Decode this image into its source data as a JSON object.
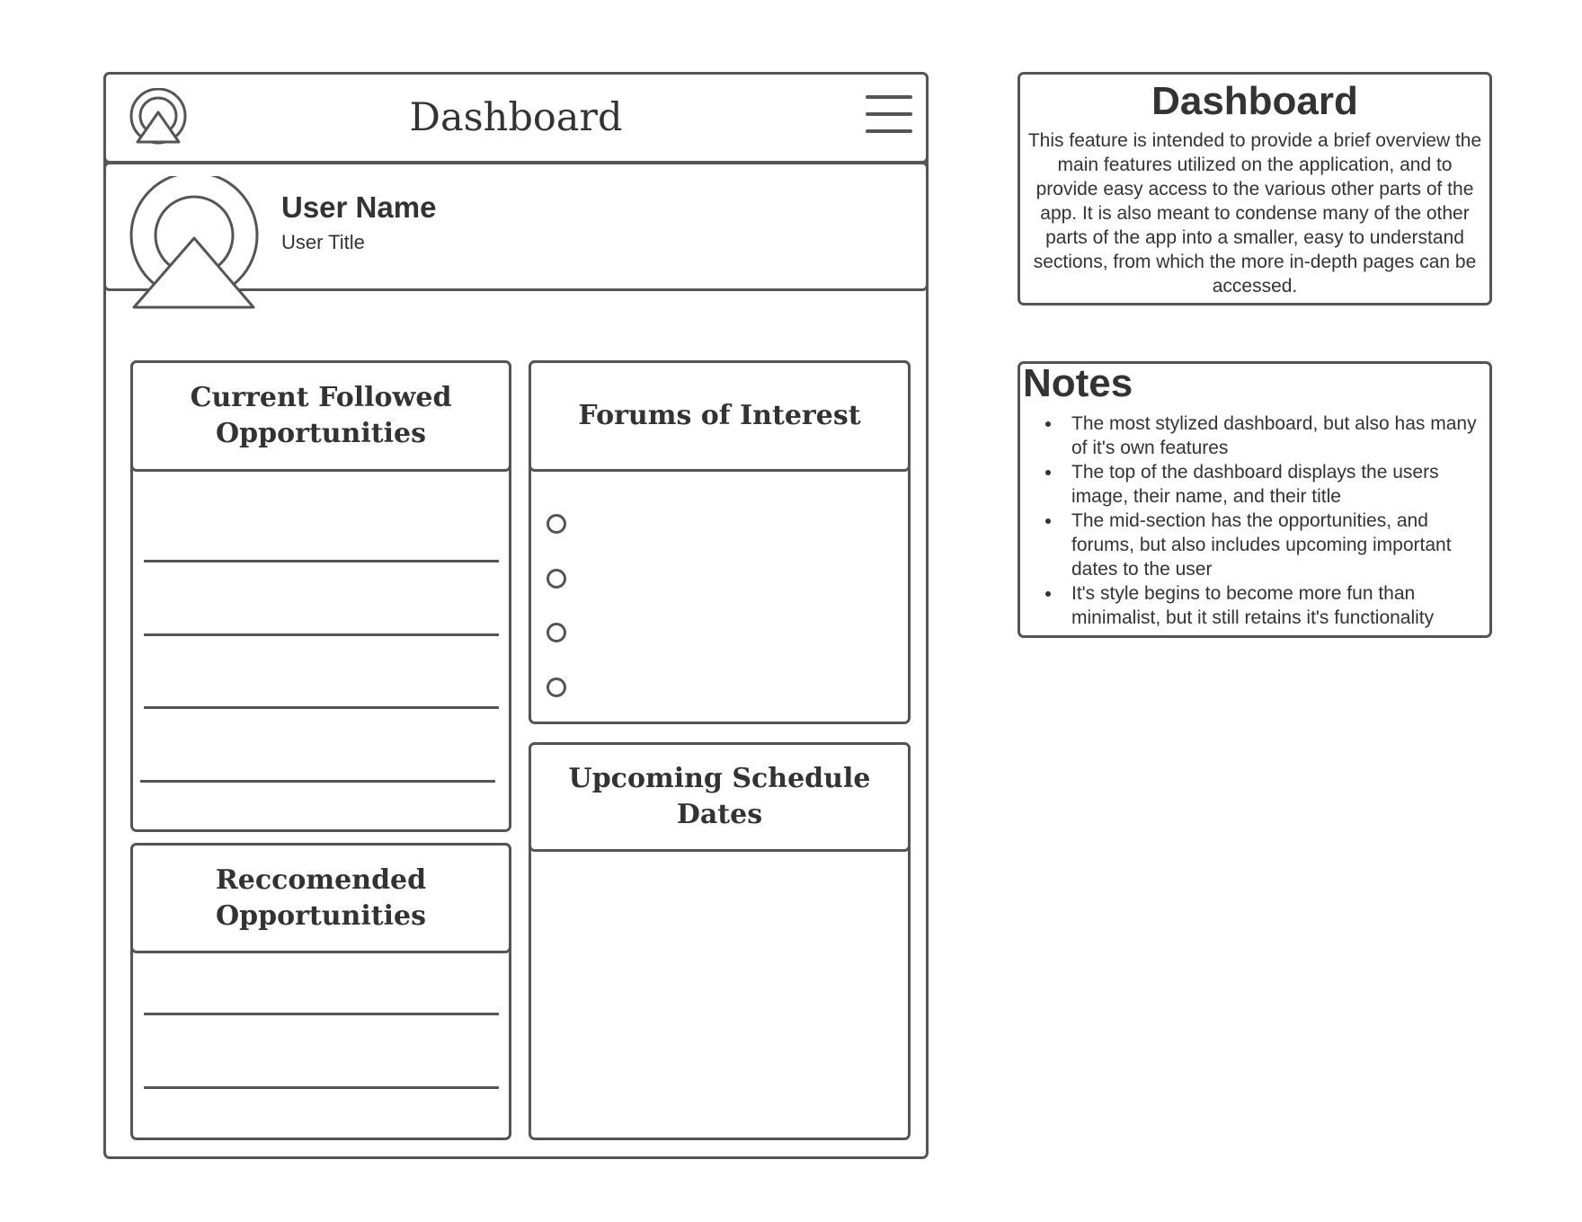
{
  "app": {
    "title": "Dashboard"
  },
  "profile": {
    "user_name": "User Name",
    "user_title": "User Title"
  },
  "cards": {
    "followed": {
      "title": "Current Followed Opportunities"
    },
    "forums": {
      "title": "Forums of Interest"
    },
    "schedule": {
      "title": "Upcoming Schedule Dates"
    },
    "recommended": {
      "title": "Reccomended Opportunities"
    }
  },
  "description": {
    "title": "Dashboard",
    "text": "This feature is intended to provide a brief overview the main features utilized on the application, and to provide easy access to the various other parts of the app. It is also meant to condense many of the other parts of the app into a smaller, easy to understand sections, from which the more in-depth pages can be accessed."
  },
  "notes": {
    "title": "Notes",
    "items": [
      "The most stylized dashboard, but also has many of it's own features",
      "The top of the dashboard displays the users image, their name, and their title",
      "The mid-section has the opportunities, and forums, but also includes upcoming important dates to the user",
      "It's style begins to become more fun than minimalist, but it still retains it's functionality"
    ]
  },
  "icons": {
    "logo": "user-avatar-icon",
    "menu": "hamburger-menu-icon",
    "avatar": "user-avatar-icon",
    "forum_bullets": "radio-circle-icon"
  },
  "colors": {
    "stroke": "#555555",
    "text": "#333333",
    "background": "#ffffff"
  }
}
